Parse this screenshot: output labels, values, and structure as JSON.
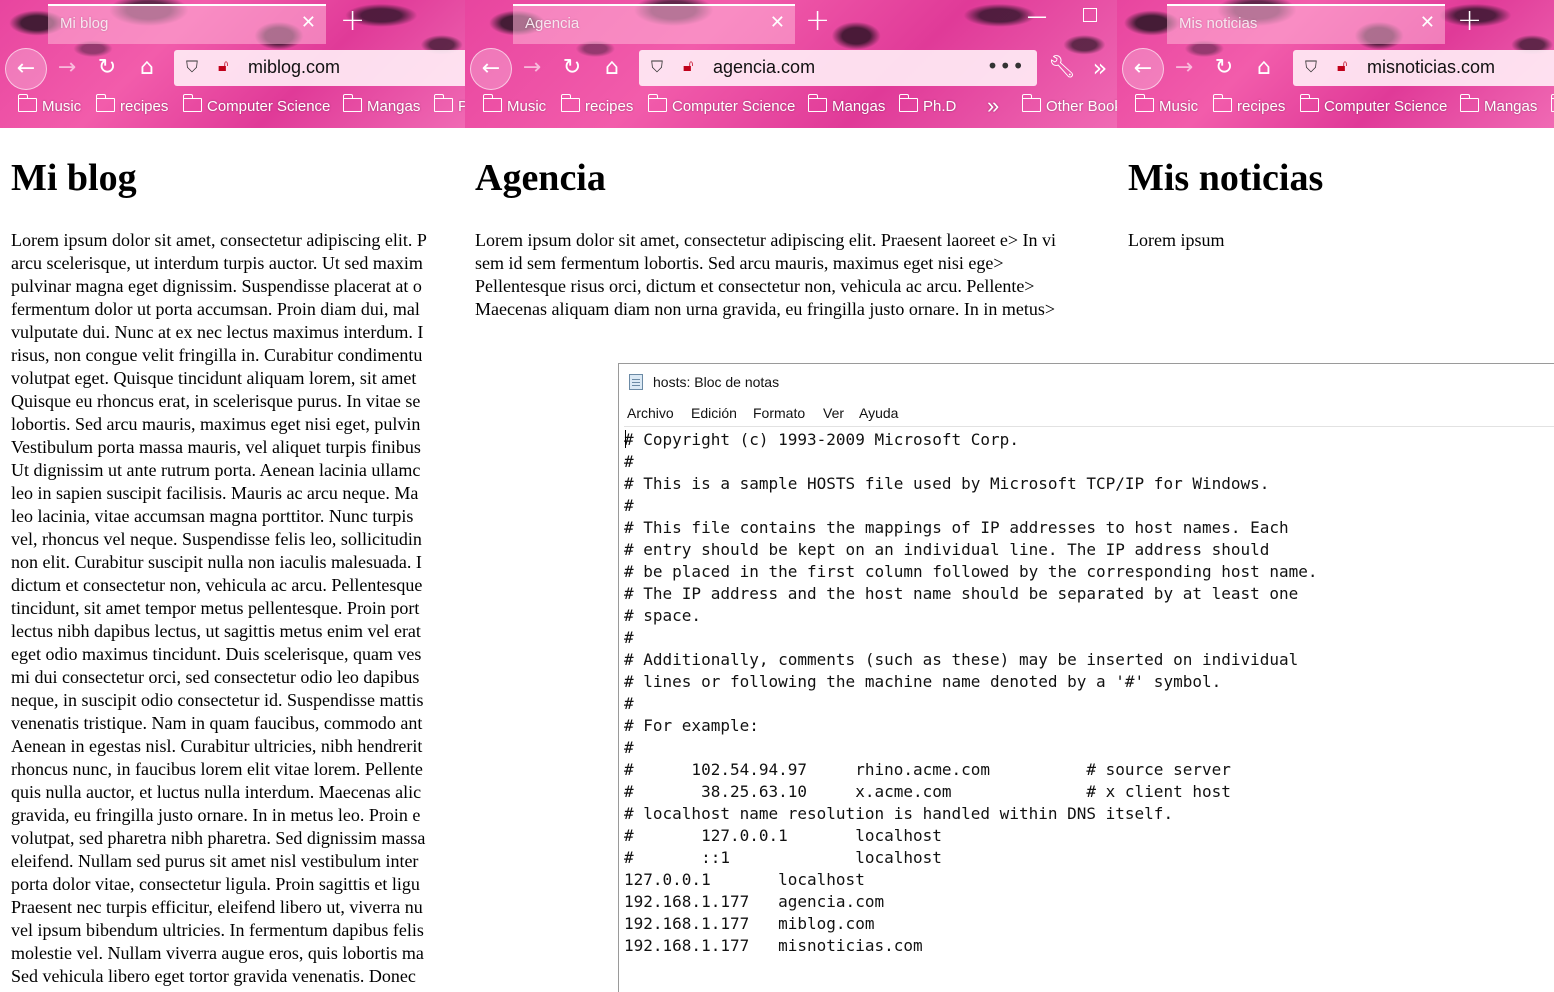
{
  "bookmarks": [
    "Music",
    "recipes",
    "Computer Science",
    "Mangas",
    "Ph.D"
  ],
  "bookmarks_overflow": "»",
  "other_bookmarks": "Other Bookmarks",
  "window1": {
    "tab_title": "Mi blog",
    "url": "miblog.com",
    "heading": "Mi blog",
    "partial_bookmark": "P",
    "lines": [
      "Lorem ipsum dolor sit amet, consectetur adipiscing elit. P",
      "arcu scelerisque, ut interdum turpis auctor. Ut sed maxim",
      "pulvinar magna eget dignissim. Suspendisse placerat at o",
      "fermentum dolor ut porta accumsan. Proin diam dui, mal",
      "vulputate dui. Nunc at ex nec lectus maximus interdum. I",
      "risus, non congue velit fringilla in. Curabitur condimentu",
      "volutpat eget. Quisque tincidunt aliquam lorem, sit amet",
      "Quisque eu rhoncus erat, in scelerisque purus. In vitae se",
      "lobortis. Sed arcu mauris, maximus eget nisi eget, pulvin",
      "Vestibulum porta massa mauris, vel aliquet turpis finibus",
      "Ut dignissim ut ante rutrum porta. Aenean lacinia ullamc",
      "leo in sapien suscipit facilisis. Mauris ac arcu neque. Ma",
      "leo lacinia, vitae accumsan magna porttitor. Nunc turpis",
      "vel, rhoncus vel neque. Suspendisse felis leo, sollicitudin",
      "non elit. Curabitur suscipit nulla non iaculis malesuada. I",
      "dictum et consectetur non, vehicula ac arcu. Pellentesque",
      "tincidunt, sit amet tempor metus pellentesque. Proin port",
      "lectus nibh dapibus lectus, ut sagittis metus enim vel erat",
      "eget odio maximus tincidunt. Duis scelerisque, quam ves",
      "mi dui consectetur orci, sed consectetur odio leo dapibus",
      "neque, in suscipit odio consectetur id. Suspendisse mattis",
      "venenatis tristique. Nam in quam faucibus, commodo ant",
      "Aenean in egestas nisl. Curabitur ultricies, nibh hendrerit",
      "rhoncus nunc, in faucibus lorem elit vitae lorem. Pellente",
      "quis nulla auctor, et luctus nulla interdum. Maecenas alic",
      "gravida, eu fringilla justo ornare. In in metus leo. Proin e",
      "volutpat, sed pharetra nibh pharetra. Sed dignissim massa",
      "eleifend. Nullam sed purus sit amet nisl vestibulum inter",
      "porta dolor vitae, consectetur ligula. Proin sagittis et ligu",
      "Praesent nec turpis efficitur, eleifend libero ut, viverra nu",
      "vel ipsum bibendum ultricies. In fermentum dapibus felis",
      "molestie vel. Nullam viverra augue eros, quis lobortis ma",
      "Sed vehicula libero eget tortor gravida venenatis. Donec"
    ]
  },
  "window2": {
    "tab_title": "Agencia",
    "url": "agencia.com",
    "heading": "Agencia",
    "lines": [
      "Lorem ipsum dolor sit amet, consectetur adipiscing elit. Praesent laoreet e> In vi",
      "sem id sem fermentum lobortis. Sed arcu mauris, maximus eget nisi ege>",
      "Pellentesque risus orci, dictum et consectetur non, vehicula ac arcu. Pellente>",
      "Maecenas aliquam diam non urna gravida, eu fringilla justo ornare. In in metus>"
    ]
  },
  "window3": {
    "tab_title": "Mis noticias",
    "url": "misnoticias.com",
    "heading": "Mis noticias",
    "lines": [
      "Lorem ipsum"
    ]
  },
  "notepad": {
    "title": "hosts: Bloc de notas",
    "menu": [
      "Archivo",
      "Edición",
      "Formato",
      "Ver",
      "Ayuda"
    ],
    "lines": [
      "# Copyright (c) 1993-2009 Microsoft Corp.",
      "#",
      "# This is a sample HOSTS file used by Microsoft TCP/IP for Windows.",
      "#",
      "# This file contains the mappings of IP addresses to host names. Each",
      "# entry should be kept on an individual line. The IP address should",
      "# be placed in the first column followed by the corresponding host name.",
      "# The IP address and the host name should be separated by at least one",
      "# space.",
      "#",
      "# Additionally, comments (such as these) may be inserted on individual",
      "# lines or following the machine name denoted by a '#' symbol.",
      "#",
      "# For example:",
      "#",
      "#      102.54.94.97     rhino.acme.com          # source server",
      "#       38.25.63.10     x.acme.com              # x client host",
      "# localhost name resolution is handled within DNS itself.",
      "#       127.0.0.1       localhost",
      "#       ::1             localhost",
      "127.0.0.1       localhost",
      "192.168.1.177   agencia.com",
      "192.168.1.177   miblog.com",
      "192.168.1.177   misnoticias.com"
    ]
  }
}
